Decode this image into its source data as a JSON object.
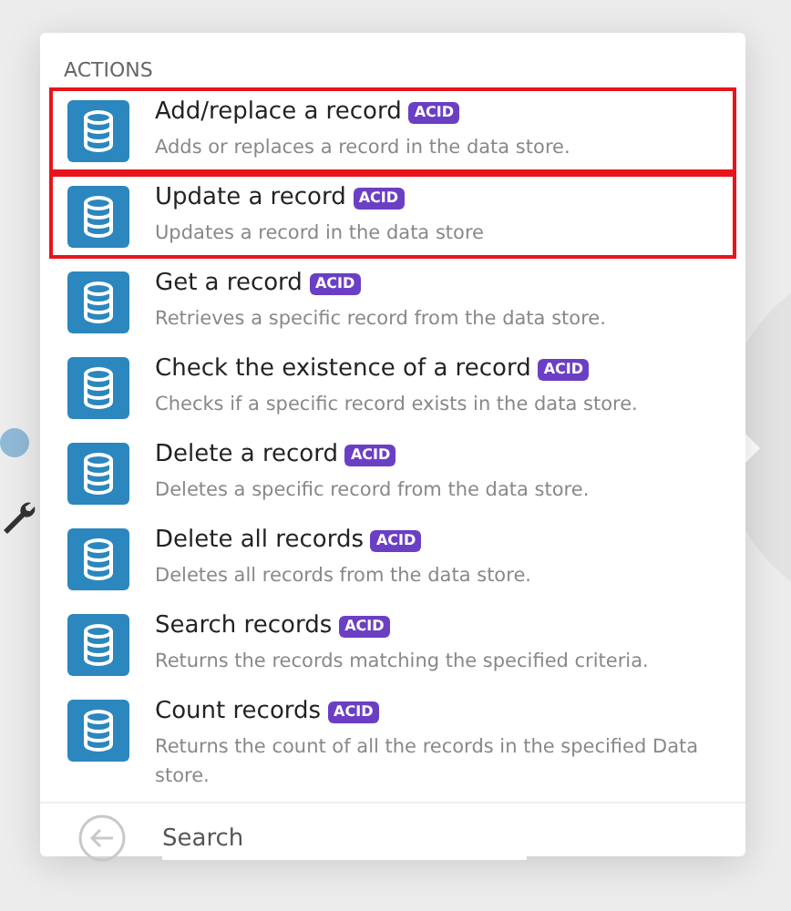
{
  "section_title": "ACTIONS",
  "actions": [
    {
      "title": "Add/replace a record",
      "badge": "ACID",
      "description": "Adds or replaces a record in the data store.",
      "highlighted": true
    },
    {
      "title": "Update a record",
      "badge": "ACID",
      "description": "Updates a record in the data store",
      "highlighted": true
    },
    {
      "title": "Get a record",
      "badge": "ACID",
      "description": "Retrieves a specific record from the data store.",
      "highlighted": false
    },
    {
      "title": "Check the existence of a record",
      "badge": "ACID",
      "description": "Checks if a specific record exists in the data store.",
      "highlighted": false
    },
    {
      "title": "Delete a record",
      "badge": "ACID",
      "description": "Deletes a specific record from the data store.",
      "highlighted": false
    },
    {
      "title": "Delete all records",
      "badge": "ACID",
      "description": "Deletes all records from the data store.",
      "highlighted": false
    },
    {
      "title": "Search records",
      "badge": "ACID",
      "description": "Returns the records matching the specified criteria.",
      "highlighted": false
    },
    {
      "title": "Count records",
      "badge": "ACID",
      "description": "Returns the count of all the records in the specified Data store.",
      "highlighted": false
    }
  ],
  "search": {
    "placeholder": "Search"
  }
}
